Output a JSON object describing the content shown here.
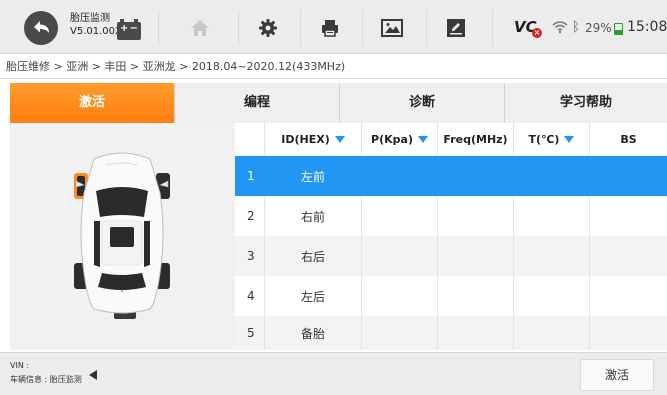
{
  "header": {
    "app_title": "胎压监测",
    "app_version": "V5.01.002",
    "battery_signs": [
      "+",
      "−"
    ],
    "vci_label": "VC",
    "battery_percent": "29%",
    "clock": "15:08"
  },
  "toolbar": {
    "icons": [
      "back-icon",
      "home-icon",
      "gear-icon",
      "printer-icon",
      "image-icon",
      "edit-icon"
    ]
  },
  "breadcrumb": "胎压维修 > 亚洲 > 丰田 > 亚洲龙 > 2018.04~2020.12(433MHz)",
  "tabs": [
    {
      "label": "激活",
      "active": true
    },
    {
      "label": "编程",
      "active": false
    },
    {
      "label": "诊断",
      "active": false
    },
    {
      "label": "学习帮助",
      "active": false
    }
  ],
  "table": {
    "headers": [
      "",
      "ID(HEX)",
      "P(Kpa)",
      "Freq(MHz)",
      "T(℃)",
      "BS"
    ],
    "sortable_headers": [
      1,
      2,
      4
    ],
    "rows": [
      {
        "num": "1",
        "position": "左前",
        "selected": true
      },
      {
        "num": "2",
        "position": "右前",
        "selected": false
      },
      {
        "num": "3",
        "position": "右后",
        "selected": false
      },
      {
        "num": "4",
        "position": "左后",
        "selected": false
      },
      {
        "num": "5",
        "position": "备胎",
        "selected": false
      }
    ]
  },
  "footer": {
    "vin_label": "VIN :",
    "vehicle_info": "车辆信息 : 胎压监测",
    "activate_button": "激活"
  },
  "colors": {
    "accent_orange": "#ff8a1f",
    "selected_blue": "#2196f3",
    "highlight_tire": "#ff8a1f"
  }
}
